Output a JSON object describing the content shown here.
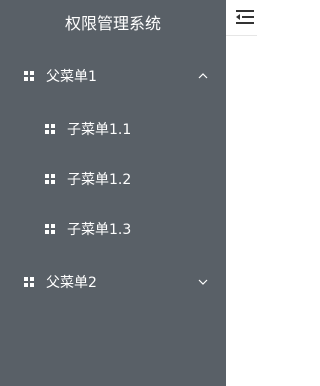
{
  "app": {
    "title": "权限管理系统"
  },
  "sidebar": {
    "menus": [
      {
        "label": "父菜单1",
        "icon": "grid-icon",
        "expanded": true,
        "children": [
          {
            "label": "子菜单1.1",
            "icon": "grid-icon"
          },
          {
            "label": "子菜单1.2",
            "icon": "grid-icon"
          },
          {
            "label": "子菜单1.3",
            "icon": "grid-icon"
          }
        ]
      },
      {
        "label": "父菜单2",
        "icon": "grid-icon",
        "expanded": false,
        "children": []
      }
    ]
  },
  "topbar": {
    "fold_icon": "menu-fold-icon"
  },
  "colors": {
    "sidebar_bg": "#596067",
    "text": "#ffffff",
    "main_bg": "#ffffff"
  }
}
